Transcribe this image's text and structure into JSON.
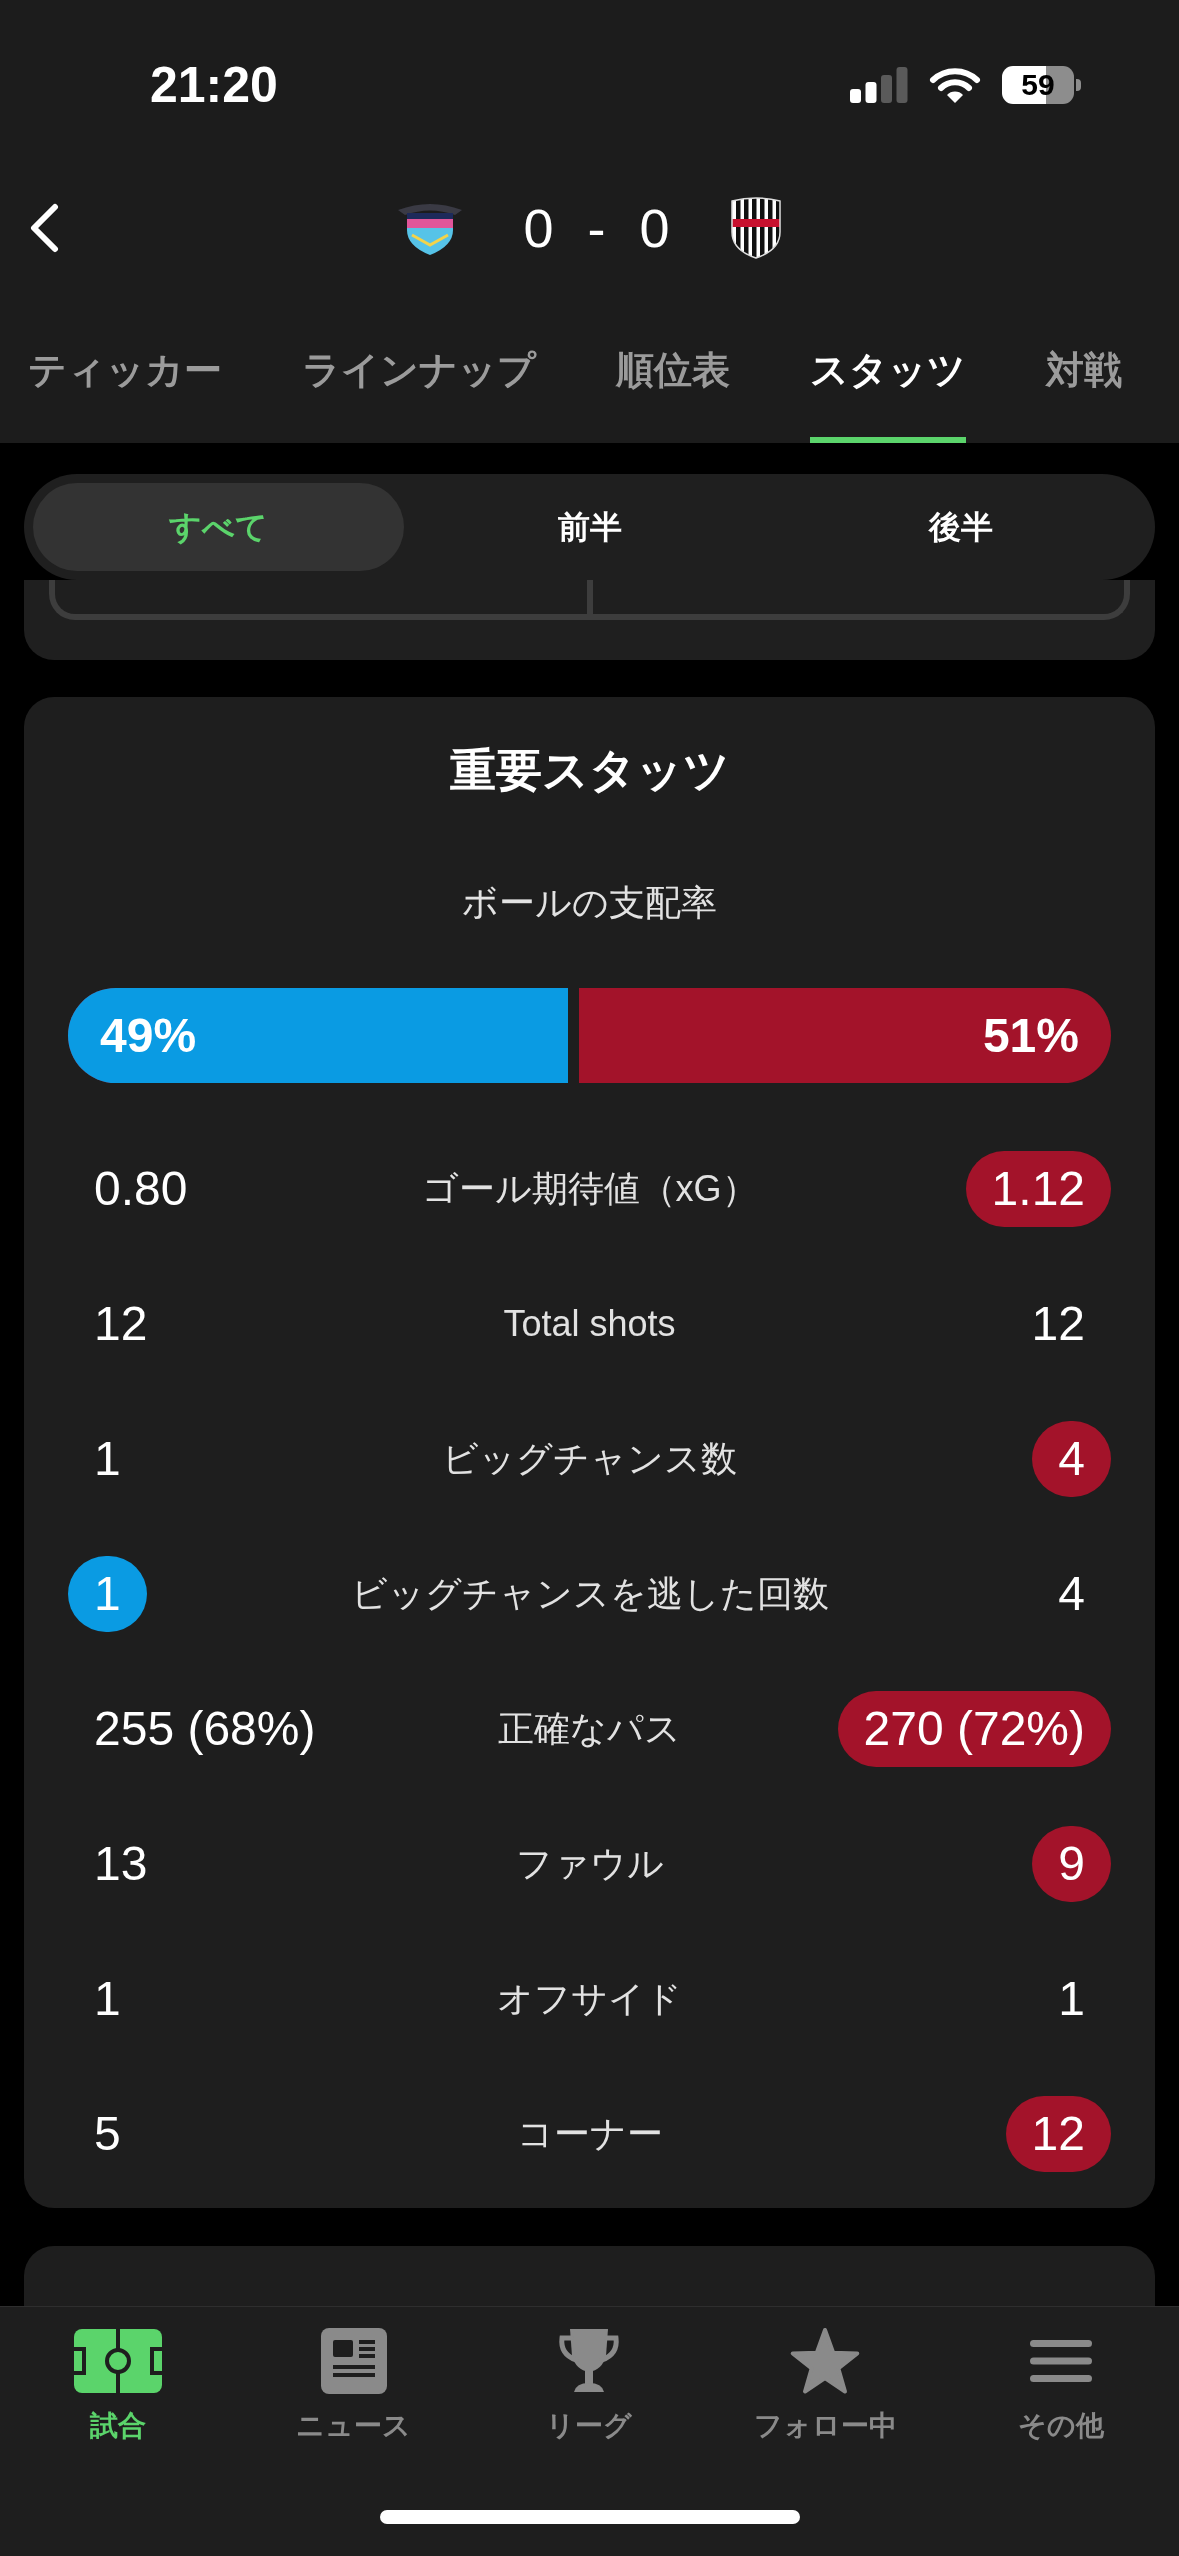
{
  "status_bar": {
    "time": "21:20",
    "battery": "59"
  },
  "match_header": {
    "home_score": "0",
    "separator": "-",
    "away_score": "0"
  },
  "tabs": [
    {
      "label": "ティッカー",
      "selected": false
    },
    {
      "label": "ラインナップ",
      "selected": false
    },
    {
      "label": "順位表",
      "selected": false
    },
    {
      "label": "スタッツ",
      "selected": true
    },
    {
      "label": "対戦",
      "selected": false
    }
  ],
  "period_filter": [
    {
      "label": "すべて",
      "selected": true
    },
    {
      "label": "前半",
      "selected": false
    },
    {
      "label": "後半",
      "selected": false
    }
  ],
  "key_stats": {
    "title": "重要スタッツ",
    "possession": {
      "label": "ボールの支配率",
      "home": "49%",
      "away": "51%",
      "level": 0.49
    },
    "rows": [
      {
        "label": "ゴール期待値（xG）",
        "home": {
          "value": "0.80",
          "highlighted": false
        },
        "away": {
          "value": "1.12",
          "highlighted": true
        }
      },
      {
        "label": "Total shots",
        "home": {
          "value": "12",
          "highlighted": false
        },
        "away": {
          "value": "12",
          "highlighted": false
        }
      },
      {
        "label": "ビッグチャンス数",
        "home": {
          "value": "1",
          "highlighted": false
        },
        "away": {
          "value": "4",
          "highlighted": true
        }
      },
      {
        "label": "ビッグチャンスを逃した回数",
        "home": {
          "value": "1",
          "highlighted": true
        },
        "away": {
          "value": "4",
          "highlighted": false
        }
      },
      {
        "label": "正確なパス",
        "home": {
          "value": "255 (68%)",
          "highlighted": false
        },
        "away": {
          "value": "270 (72%)",
          "highlighted": true
        }
      },
      {
        "label": "ファウル",
        "home": {
          "value": "13",
          "highlighted": false
        },
        "away": {
          "value": "9",
          "highlighted": true
        }
      },
      {
        "label": "オフサイド",
        "home": {
          "value": "1",
          "highlighted": false
        },
        "away": {
          "value": "1",
          "highlighted": false
        }
      },
      {
        "label": "コーナー",
        "home": {
          "value": "5",
          "highlighted": false
        },
        "away": {
          "value": "12",
          "highlighted": true
        }
      }
    ]
  },
  "bottom_nav": [
    {
      "label": "試合",
      "selected": true
    },
    {
      "label": "ニュース",
      "selected": false
    },
    {
      "label": "リーグ",
      "selected": false
    },
    {
      "label": "フォロー中",
      "selected": false
    },
    {
      "label": "その他",
      "selected": false
    }
  ]
}
